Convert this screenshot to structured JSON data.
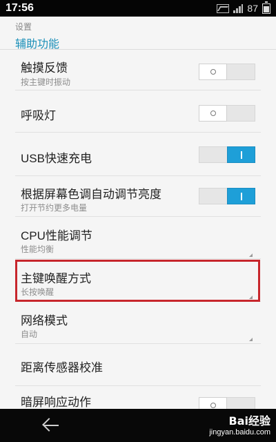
{
  "status_bar": {
    "time": "17:56",
    "battery_level": "87",
    "icons": [
      "image-icon",
      "signal-icon",
      "battery-icon"
    ]
  },
  "header": {
    "parent": "设置",
    "title": "辅助功能"
  },
  "settings": [
    {
      "title": "触摸反馈",
      "subtitle": "按主键时振动",
      "control": "toggle",
      "checked": false
    },
    {
      "title": "呼吸灯",
      "control": "toggle",
      "checked": false
    },
    {
      "title": "USB快速充电",
      "control": "toggle",
      "checked": true
    },
    {
      "title": "根据屏幕色调自动调节亮度",
      "subtitle": "打开节约更多电量",
      "control": "toggle",
      "checked": true
    },
    {
      "title": "CPU性能调节",
      "subtitle": "性能均衡",
      "control": "dropdown"
    },
    {
      "title": "主键唤醒方式",
      "subtitle": "长按唤醒",
      "control": "dropdown",
      "highlighted": true
    },
    {
      "title": "网络模式",
      "subtitle": "自动",
      "control": "dropdown"
    },
    {
      "title": "距离传感器校准",
      "control": "none"
    },
    {
      "title": "暗屏响应动作",
      "control": "toggle",
      "checked": false
    }
  ],
  "watermark": {
    "logo": "Bai经验",
    "url": "jingyan.baidu.com"
  },
  "colors": {
    "accent": "#1e9fd8",
    "title_accent": "#1a8fb8",
    "highlight": "#c7262c"
  }
}
